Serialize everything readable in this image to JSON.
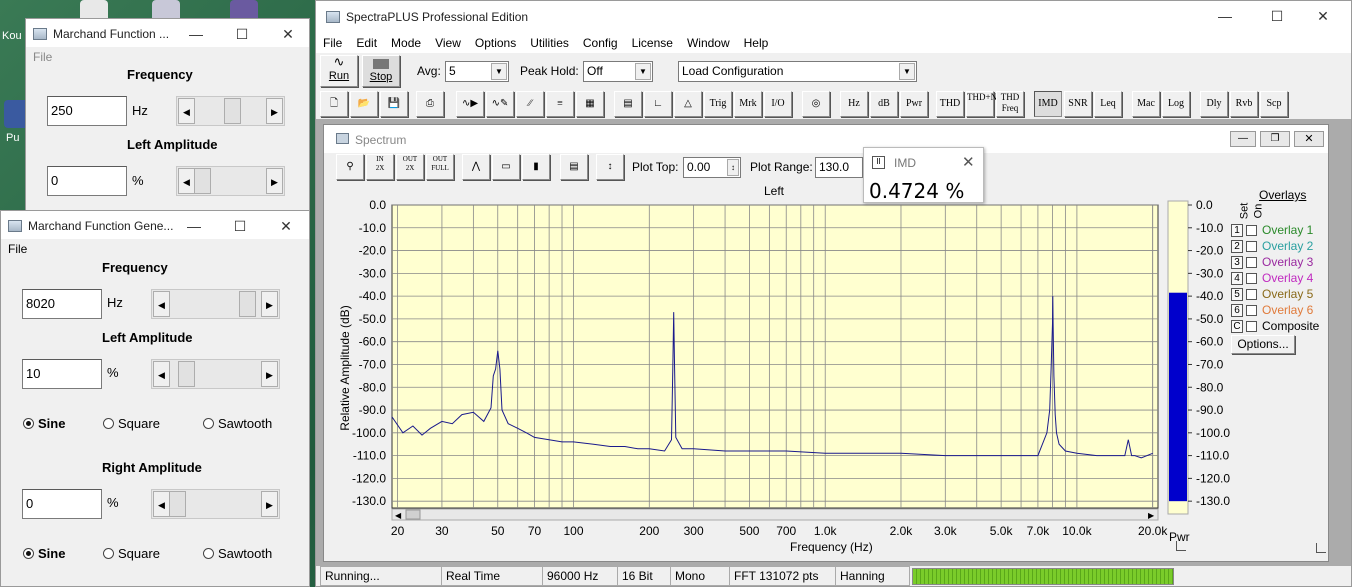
{
  "desktop": {
    "label1": "Kou",
    "label2": "Pu"
  },
  "gen1": {
    "title": "Marchand Function ...",
    "menu_file": "File",
    "freq_label": "Frequency",
    "freq_value": "250",
    "hz": "Hz",
    "amp_label": "Left Amplitude",
    "amp_value": "0",
    "pct": "%"
  },
  "gen2": {
    "title": "Marchand Function Gene...",
    "menu_file": "File",
    "freq_label": "Frequency",
    "freq_value": "8020",
    "hz": "Hz",
    "left_amp_label": "Left Amplitude",
    "left_amp_value": "10",
    "pct": "%",
    "right_amp_label": "Right Amplitude",
    "right_amp_value": "0",
    "wave1": {
      "sine": "Sine",
      "square": "Square",
      "sawtooth": "Sawtooth"
    },
    "wave2": {
      "sine": "Sine",
      "square": "Square",
      "sawtooth": "Sawtooth"
    }
  },
  "app": {
    "title": "SpectraPLUS Professional Edition",
    "menu": [
      "File",
      "Edit",
      "Mode",
      "View",
      "Options",
      "Utilities",
      "Config",
      "License",
      "Window",
      "Help"
    ],
    "run": "Run",
    "stop": "Stop",
    "avg_label": "Avg:",
    "avg_value": "5",
    "peak_label": "Peak Hold:",
    "peak_value": "Off",
    "config_value": "Load Configuration",
    "toolbar2": [
      "Trig",
      "Mrk",
      "I/O",
      "Hz",
      "dB",
      "Pwr",
      "THD",
      "THD+N",
      "THD Freq",
      "IMD",
      "SNR",
      "Leq",
      "Mac",
      "Log",
      "Dly",
      "Rvb",
      "Scp"
    ]
  },
  "spectrum": {
    "title": "Spectrum",
    "plot_top_label": "Plot Top:",
    "plot_top_value": "0.00",
    "plot_range_label": "Plot Range:",
    "plot_range_value": "130.0",
    "channel": "Left",
    "ylabel": "Relative Amplitude (dB)",
    "xlabel": "Frequency (Hz)",
    "pwr_label": "Pwr"
  },
  "imd": {
    "title": "IMD",
    "value": "0.4724 %"
  },
  "overlays": {
    "title": "Overlays",
    "set": "Set",
    "on": "On",
    "items": [
      {
        "n": "1",
        "name": "Overlay 1",
        "color": "#2a8a2a"
      },
      {
        "n": "2",
        "name": "Overlay 2",
        "color": "#2aa0a0"
      },
      {
        "n": "3",
        "name": "Overlay 3",
        "color": "#9a2aa0"
      },
      {
        "n": "4",
        "name": "Overlay 4",
        "color": "#c02ac0"
      },
      {
        "n": "5",
        "name": "Overlay 5",
        "color": "#8a6a1a"
      },
      {
        "n": "6",
        "name": "Overlay 6",
        "color": "#e07a3a"
      },
      {
        "n": "C",
        "name": "Composite",
        "color": "#000000"
      }
    ],
    "options": "Options..."
  },
  "status": {
    "s1": "Running...",
    "s2": "Real Time",
    "s3": "96000 Hz",
    "s4": "16 Bit",
    "s5": "Mono",
    "s6": "FFT 131072 pts",
    "s7": "Hanning"
  },
  "chart_data": {
    "type": "line",
    "xlabel": "Frequency (Hz)",
    "ylabel": "Relative Amplitude (dB)",
    "x_scale": "log",
    "xlim": [
      19,
      21000
    ],
    "ylim": [
      -133,
      0
    ],
    "yticks": [
      "0.0",
      "-10.0",
      "-20.0",
      "-30.0",
      "-40.0",
      "-50.0",
      "-60.0",
      "-70.0",
      "-80.0",
      "-90.0",
      "-100.0",
      "-110.0",
      "-120.0",
      "-130.0"
    ],
    "xticks": [
      "20",
      "30",
      "50",
      "70",
      "100",
      "200",
      "300",
      "500",
      "700",
      "1.0k",
      "2.0k",
      "3.0k",
      "5.0k",
      "7.0k",
      "10.0k",
      "20.0k"
    ],
    "series": [
      {
        "color": "#1a1a8c",
        "x": [
          19,
          21,
          23,
          25,
          27,
          30,
          33,
          36,
          40,
          44,
          47,
          48,
          49,
          50,
          51,
          52,
          55,
          60,
          65,
          70,
          80,
          90,
          100,
          120,
          140,
          160,
          180,
          200,
          230,
          245,
          248,
          250,
          252,
          255,
          270,
          300,
          400,
          500,
          700,
          1000,
          1500,
          2000,
          3000,
          4000,
          5000,
          6000,
          7000,
          7600,
          7800,
          7900,
          8000,
          8020,
          8040,
          8100,
          8200,
          8300,
          8500,
          9000,
          10000,
          12000,
          14000,
          15500,
          16000,
          16500,
          17000,
          18000,
          20000
        ],
        "y": [
          -93,
          -100,
          -97,
          -101,
          -98,
          -95,
          -96,
          -92,
          -91,
          -95,
          -89,
          -75,
          -72,
          -64,
          -72,
          -90,
          -96,
          -98,
          -100,
          -102,
          -103,
          -104,
          -104,
          -105,
          -106,
          -106,
          -107,
          -107,
          -108,
          -103,
          -72,
          -47,
          -72,
          -102,
          -107,
          -107,
          -108,
          -108,
          -108,
          -109,
          -109,
          -109,
          -110,
          -110,
          -110,
          -110,
          -110,
          -100,
          -90,
          -72,
          -52,
          -40,
          -52,
          -75,
          -92,
          -100,
          -105,
          -108,
          -109,
          -110,
          -110,
          -110,
          -103,
          -110,
          -110,
          -111,
          -109
        ]
      }
    ],
    "level_bar": {
      "top": -38.5,
      "bottom": -130
    }
  }
}
